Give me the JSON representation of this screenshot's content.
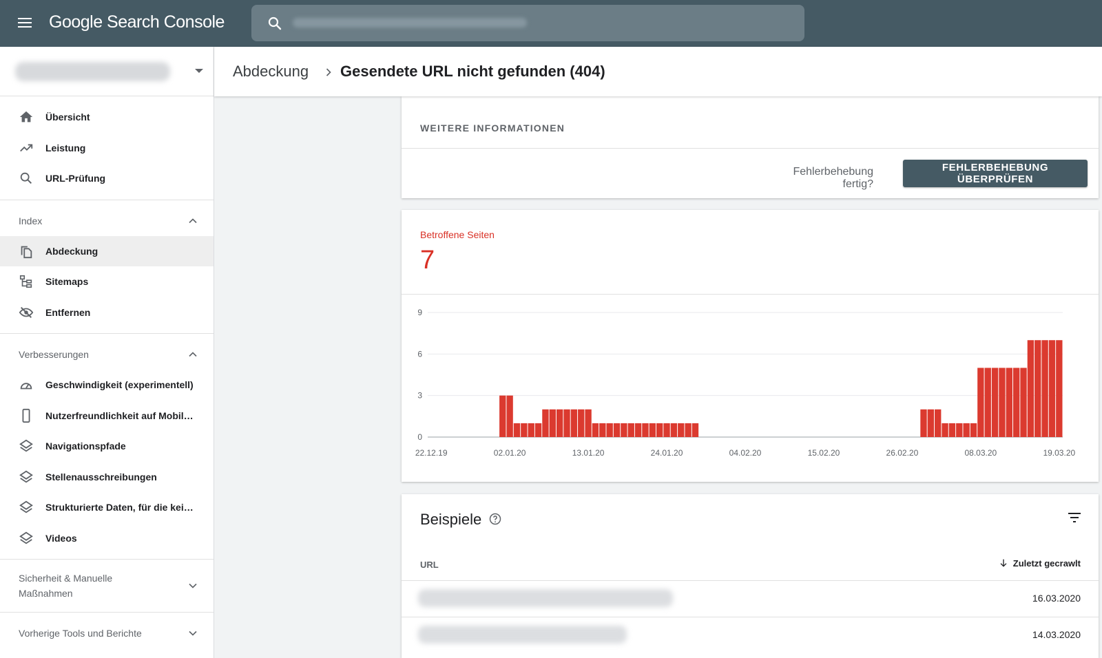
{
  "app": {
    "logo": "Google Search Console"
  },
  "sidebar": {
    "top_items": [
      {
        "label": "Übersicht",
        "icon": "home-icon"
      },
      {
        "label": "Leistung",
        "icon": "trending-up-icon"
      },
      {
        "label": "URL-Prüfung",
        "icon": "search-icon"
      }
    ],
    "index": {
      "heading": "Index",
      "items": [
        {
          "label": "Abdeckung",
          "icon": "file-copy-icon",
          "active": true
        },
        {
          "label": "Sitemaps",
          "icon": "sitemap-icon"
        },
        {
          "label": "Entfernen",
          "icon": "visibility-off-icon"
        }
      ]
    },
    "enhancements": {
      "heading": "Verbesserungen",
      "items": [
        {
          "label": "Geschwindigkeit (experimentell)",
          "icon": "speed-gauge-icon"
        },
        {
          "label": "Nutzerfreundlichkeit auf Mobil…",
          "icon": "smartphone-icon"
        },
        {
          "label": "Navigationspfade",
          "icon": "layers-icon"
        },
        {
          "label": "Stellenausschreibungen",
          "icon": "layers-icon"
        },
        {
          "label": "Strukturierte Daten, für die kein…",
          "icon": "layers-icon"
        },
        {
          "label": "Videos",
          "icon": "layers-icon"
        }
      ]
    },
    "security": {
      "heading_line1": "Sicherheit & Manuelle",
      "heading_line2": "Maßnahmen"
    },
    "legacy": {
      "heading": "Vorherige Tools und Berichte"
    }
  },
  "breadcrumb": {
    "parent": "Abdeckung",
    "current": "Gesendete URL nicht gefunden (404)"
  },
  "info": {
    "title": "WEITERE INFORMATIONEN",
    "question": "Fehlerbehebung fertig?",
    "button": "FEHLERBEHEBUNG ÜBERPRÜFEN"
  },
  "metric": {
    "label": "Betroffene Seiten",
    "value": "7",
    "color": "#d93025"
  },
  "chart_data": {
    "type": "bar",
    "ylim": [
      0,
      9
    ],
    "yticks": [
      "0",
      "3",
      "6",
      "9"
    ],
    "xtick_labels": [
      "22.12.19",
      "02.01.20",
      "13.01.20",
      "24.01.20",
      "04.02.20",
      "15.02.20",
      "26.02.20",
      "08.03.20",
      "19.03.20"
    ],
    "series": [
      {
        "color": "#db3a2f",
        "values": [
          0,
          0,
          0,
          0,
          0,
          0,
          0,
          0,
          0,
          0,
          3,
          3,
          1,
          1,
          1,
          1,
          2,
          2,
          2,
          2,
          2,
          2,
          2,
          1,
          1,
          1,
          1,
          1,
          1,
          1,
          1,
          1,
          1,
          1,
          1,
          1,
          1,
          1,
          0,
          0,
          0,
          0,
          0,
          0,
          0,
          0,
          0,
          0,
          0,
          0,
          0,
          0,
          0,
          0,
          0,
          0,
          0,
          0,
          0,
          0,
          0,
          0,
          0,
          0,
          0,
          0,
          0,
          0,
          0,
          2,
          2,
          2,
          1,
          1,
          1,
          1,
          1,
          5,
          5,
          5,
          5,
          5,
          5,
          5,
          7,
          7,
          7,
          7,
          7
        ]
      }
    ]
  },
  "examples": {
    "title": "Beispiele",
    "col_url": "URL",
    "col_crawled": "Zuletzt gecrawlt",
    "rows": [
      {
        "date": "16.03.2020"
      },
      {
        "date": "14.03.2020"
      }
    ]
  }
}
